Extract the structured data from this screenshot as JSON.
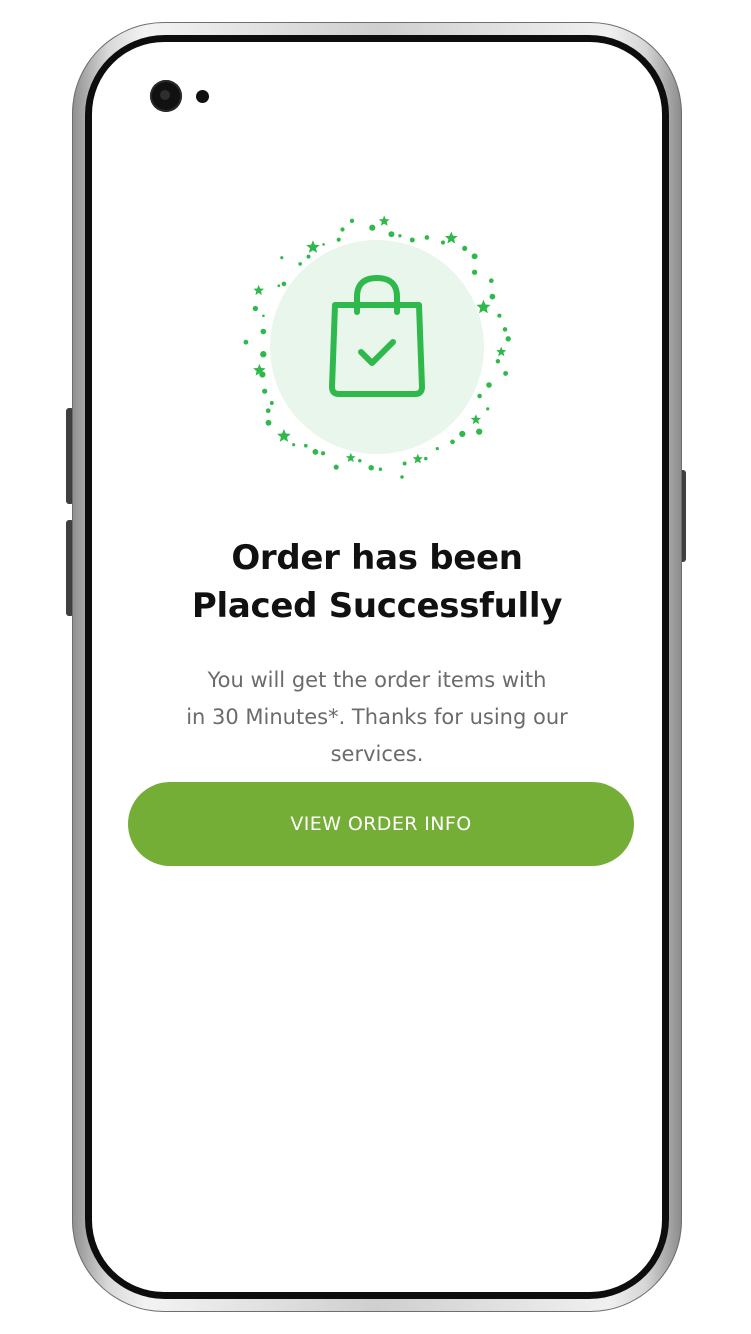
{
  "success_screen": {
    "title_line1": "Order has been",
    "title_line2": "Placed Successfully",
    "message_line1": "You will get the order items with",
    "message_line2": "in 30 Minutes*. Thanks for using our",
    "message_line3": "services.",
    "cta_label": "VIEW ORDER INFO",
    "illustration_icon": "shopping-bag-check-icon"
  },
  "colors": {
    "accent_green": "#75ae36",
    "icon_green": "#2fb84b",
    "halo_green": "#e9f6ec",
    "title_text": "#111111",
    "body_text": "#6b6b6b"
  }
}
